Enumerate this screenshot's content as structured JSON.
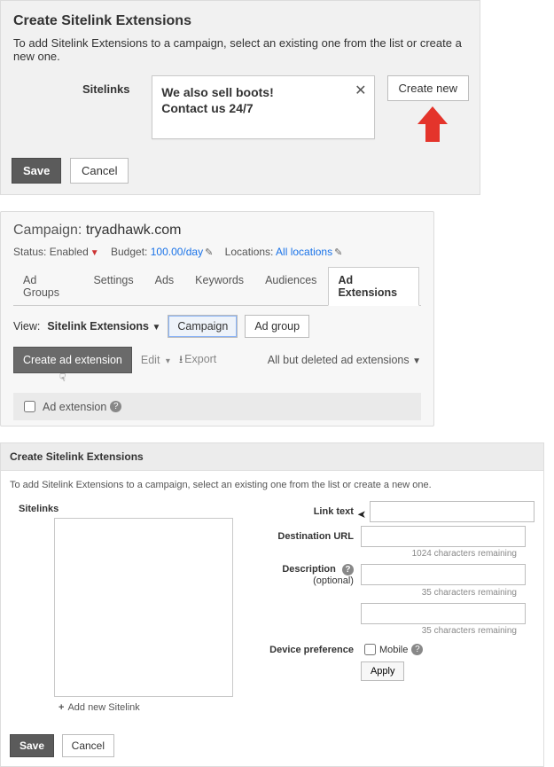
{
  "panel1": {
    "title": "Create Sitelink Extensions",
    "subtext": "To add Sitelink Extensions to a campaign, select an existing one from the list or create a new one.",
    "sitelinks_label": "Sitelinks",
    "token_lines": [
      "We also sell boots!",
      "Contact us 24/7"
    ],
    "create_new": "Create new",
    "save": "Save",
    "cancel": "Cancel"
  },
  "panel2": {
    "campaign_prefix": "Campaign: ",
    "campaign_name": "tryadhawk.com",
    "status_label": "Status:",
    "status_value": "Enabled",
    "budget_label": "Budget:",
    "budget_value": "100.00/day",
    "locations_label": "Locations:",
    "locations_value": "All locations",
    "tabs": [
      "Ad Groups",
      "Settings",
      "Ads",
      "Keywords",
      "Audiences",
      "Ad Extensions"
    ],
    "active_tab_index": 5,
    "view_label": "View:",
    "view_value": "Sitelink Extensions",
    "scope": [
      "Campaign",
      "Ad group"
    ],
    "create_ext": "Create ad extension",
    "edit": "Edit",
    "export": "Export",
    "filter": "All but deleted ad extensions",
    "col_header": "Ad extension"
  },
  "panel3": {
    "title": "Create Sitelink Extensions",
    "subtext": "To add Sitelink Extensions to a campaign, select an existing one from the list or create a new one.",
    "sitelinks_label": "Sitelinks",
    "add_new": "Add new Sitelink",
    "link_text": "Link text",
    "dest_url": "Destination URL",
    "desc": "Description",
    "optional": "(optional)",
    "device_pref": "Device preference",
    "mobile": "Mobile",
    "apply": "Apply",
    "remain_1024": "1024 characters remaining",
    "remain_35": "35 characters remaining",
    "save": "Save",
    "cancel": "Cancel"
  }
}
